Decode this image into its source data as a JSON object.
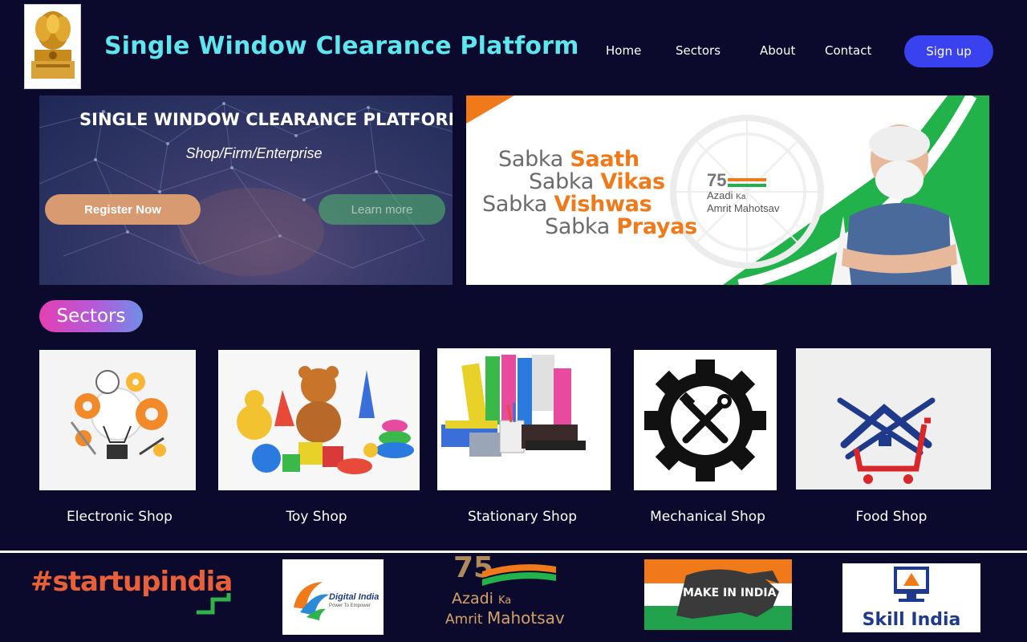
{
  "header": {
    "title": "Single Window Clearance Platform",
    "nav": [
      "Home",
      "Sectors",
      "About",
      "Contact"
    ],
    "signup_label": "Sign up"
  },
  "hero": {
    "title": "SINGLE WINDOW CLEARANCE PLATFORM",
    "subtitle": "Shop/Firm/Enterprise",
    "register_label": "Register Now",
    "learn_label": "Learn more"
  },
  "banner": {
    "lines": [
      {
        "prefix": "Sabka ",
        "highlight": "Saath"
      },
      {
        "prefix": "Sabka ",
        "highlight": "Vikas"
      },
      {
        "prefix": "Sabka ",
        "highlight": "Vishwas"
      },
      {
        "prefix": "Sabka ",
        "highlight": "Prayas"
      }
    ],
    "amrit": {
      "azadi": "Azadi",
      "ka": "Ka",
      "amrit": "Amrit",
      "mahotsav": "Mahotsav"
    }
  },
  "sectors": {
    "heading": "Sectors",
    "items": [
      "Electronic Shop",
      "Toy Shop",
      "Stationary Shop",
      "Mechanical Shop",
      "Food Shop"
    ]
  },
  "footer_logos": {
    "startup": "#startupindia",
    "digital": "Digital India",
    "digital_tag": "Power To Empower",
    "azadi": "Azadi",
    "ka": "Ka",
    "amrit": "Amrit",
    "mahotsav": "Mahotsav",
    "make": "MAKE IN INDIA",
    "skill": "Skill India"
  },
  "colors": {
    "background": "#0c0a2c",
    "title": "#5ee6ee",
    "signup": "#3a42f0",
    "saffron": "#f07a1a",
    "green": "#22b24c"
  }
}
